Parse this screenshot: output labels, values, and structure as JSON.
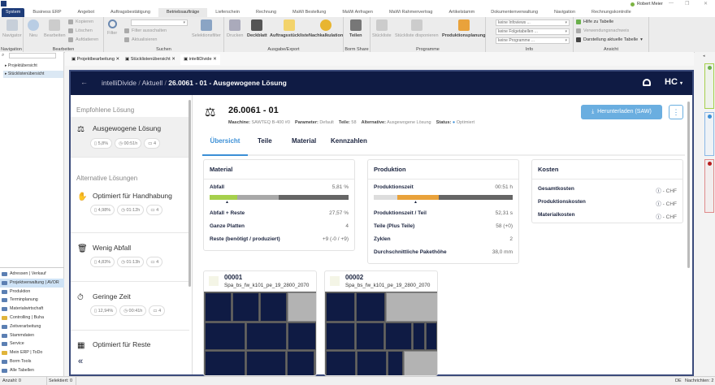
{
  "window": {
    "user": "Robert Meier",
    "min": "—",
    "max": "❐",
    "close": "✕"
  },
  "ribbon_tabs": [
    "System",
    "Business ERP",
    "Angebot",
    "Auftragsbestätigung",
    "Betriebsaufträge",
    "Lieferschein",
    "Rechnung",
    "MaWi Bestellung",
    "MaWi Anfragen",
    "MaWi Rahmenvertrag",
    "Artikelstamm",
    "Dokumentenverwaltung",
    "Navigation",
    "Rechnungskontrolle"
  ],
  "ribbon": {
    "navigation": {
      "label": "Navigation",
      "navigator": "Navigator"
    },
    "bearbeiten": {
      "label": "Bearbeiten",
      "neu": "Neu",
      "bearbeiten": "Bearbeiten",
      "kopieren": "Kopieren",
      "loeschen": "Löschen",
      "aufdatieren": "Aufdatieren"
    },
    "suchen": {
      "label": "Suchen",
      "filter": "Filter",
      "filter_aus": "Filter ausschalten",
      "aktualisieren": "Aktualisieren",
      "selektionsfilter": "Selektionsfilter"
    },
    "ausgabe": {
      "label": "Ausgabe/Export",
      "drucken": "Drucken",
      "deckblatt": "Deckblatt",
      "auftragsstueckliste": "Auftragsstückliste",
      "nachkalkulation": "Nachkalkulation"
    },
    "borm": {
      "label": "Borm Share",
      "teilen": "Teilen"
    },
    "programme": {
      "label": "Programme",
      "stueckliste": "Stückliste",
      "disponieren": "Stückliste disponieren",
      "produktionsplanung": "Produktionsplanung"
    },
    "info": {
      "label": "Info",
      "infoviews": "keine Infoviews ...",
      "folgetabellen": "keine Folgetabellen ...",
      "programme": "keine Programme ..."
    },
    "ansicht": {
      "label": "Ansicht",
      "hilfe": "Hilfe zu Tabelle",
      "verwendung": "Verwendungsnachweis",
      "darstellung": "Darstellung aktuelle Tabelle"
    }
  },
  "tree": [
    "Projektübersicht",
    "Stücklistenübersicht"
  ],
  "nav": [
    "Adressen | Verkauf",
    "Projektverwaltung | AVOR",
    "Produktion",
    "Terminplanung",
    "Materialwirtschaft",
    "Controlling | Buha",
    "Zeitverarbeitung",
    "Stammdaten",
    "Service",
    "Mein ERP | ToDo",
    "Borm Tools",
    "Alle Tabellen"
  ],
  "doc_tabs": [
    "Projektbearbeitung",
    "Stücklistenübersicht",
    "intelliDivide"
  ],
  "header": {
    "crumb1": "intelliDivide",
    "crumb2": "Aktuell",
    "crumb3": "26.0061 - 01 - Ausgewogene Lösung",
    "logo": "HC"
  },
  "side": {
    "recommended": "Empfohlene Lösung",
    "alternative": "Alternative Lösungen",
    "collapse": "«",
    "solutions": [
      {
        "title": "Ausgewogene Lösung",
        "waste": "5,8%",
        "time": "00:51h",
        "plates": "4",
        "icon": "⚖"
      },
      {
        "title": "Optimiert für Handhabung",
        "waste": "4,98%",
        "time": "01:12h",
        "plates": "4",
        "icon": "✋"
      },
      {
        "title": "Wenig Abfall",
        "waste": "4,83%",
        "time": "01:13h",
        "plates": "4",
        "icon": "🗑"
      },
      {
        "title": "Geringe Zeit",
        "waste": "12,94%",
        "time": "00:41h",
        "plates": "4",
        "icon": "⏱"
      },
      {
        "title": "Optimiert für Reste",
        "icon": "▦"
      }
    ]
  },
  "job": {
    "title": "26.0061 - 01",
    "maschine_l": "Maschine:",
    "maschine": "SAWTEQ B-400 #0",
    "parameter_l": "Parameter:",
    "parameter": "Default",
    "teile_l": "Teile:",
    "teile": "58",
    "alt_l": "Alternative:",
    "alt": "Ausgewogene Lösung",
    "status_l": "Status:",
    "status": "Optimiert",
    "download": "Herunterladen (SAW)",
    "more": "⋮"
  },
  "tabs": [
    "Übersicht",
    "Teile",
    "Material",
    "Kennzahlen"
  ],
  "material": {
    "title": "Material",
    "rows": [
      [
        "Abfall",
        "5,81 %"
      ],
      [
        "Abfall + Reste",
        "27,57 %"
      ],
      [
        "Ganze Platten",
        "4"
      ],
      [
        "Reste (benötigt / produziert)",
        "+9 (-0 / +9)"
      ]
    ],
    "bar": [
      20,
      30,
      50
    ]
  },
  "produktion": {
    "title": "Produktion",
    "rows": [
      [
        "Produktionszeit",
        "00:51 h"
      ],
      [
        "Produktionszeit / Teil",
        "52,31 s"
      ],
      [
        "Teile (Plus Teile)",
        "58 (+0)"
      ],
      [
        "Zyklen",
        "2"
      ],
      [
        "Durchschnittliche Pakethöhe",
        "38,0 mm"
      ]
    ],
    "bar": [
      17,
      30,
      53
    ]
  },
  "kosten": {
    "title": "Kosten",
    "rows": [
      [
        "Gesamtkosten",
        "- CHF"
      ],
      [
        "Produktionskosten",
        "- CHF"
      ],
      [
        "Materialkosten",
        "- CHF"
      ]
    ]
  },
  "plans": [
    {
      "id": "00001",
      "material": "Spa_bs_fw_k101_pe_19_2800_2070"
    },
    {
      "id": "00002",
      "material": "Spa_bs_fw_k101_pe_19_2800_2070"
    }
  ],
  "status": {
    "anzahl": "Anzahl: 0",
    "selektiert": "Selektiert: 0",
    "lang": "DE",
    "nachrichten": "Nachrichten: 2"
  },
  "colors": {
    "navy": "#0f1b44",
    "accent": "#3b8fd6",
    "green": "#a6d04c",
    "orange": "#e9a23b"
  }
}
